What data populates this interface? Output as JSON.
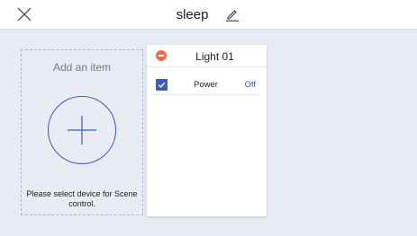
{
  "header": {
    "title": "sleep",
    "close_icon": "close-icon",
    "edit_icon": "pencil-icon"
  },
  "add_item": {
    "title": "Add an item",
    "icon": "plus-icon",
    "hint": "Please select device for Scene control."
  },
  "device": {
    "name": "Light 01",
    "remove_icon": "minus-circle-icon",
    "properties": [
      {
        "name": "Power",
        "value": "Off",
        "checked": true
      }
    ]
  },
  "colors": {
    "accent": "#3d5bb8",
    "danger": "#f06a4e",
    "background": "#e8ebf2"
  }
}
